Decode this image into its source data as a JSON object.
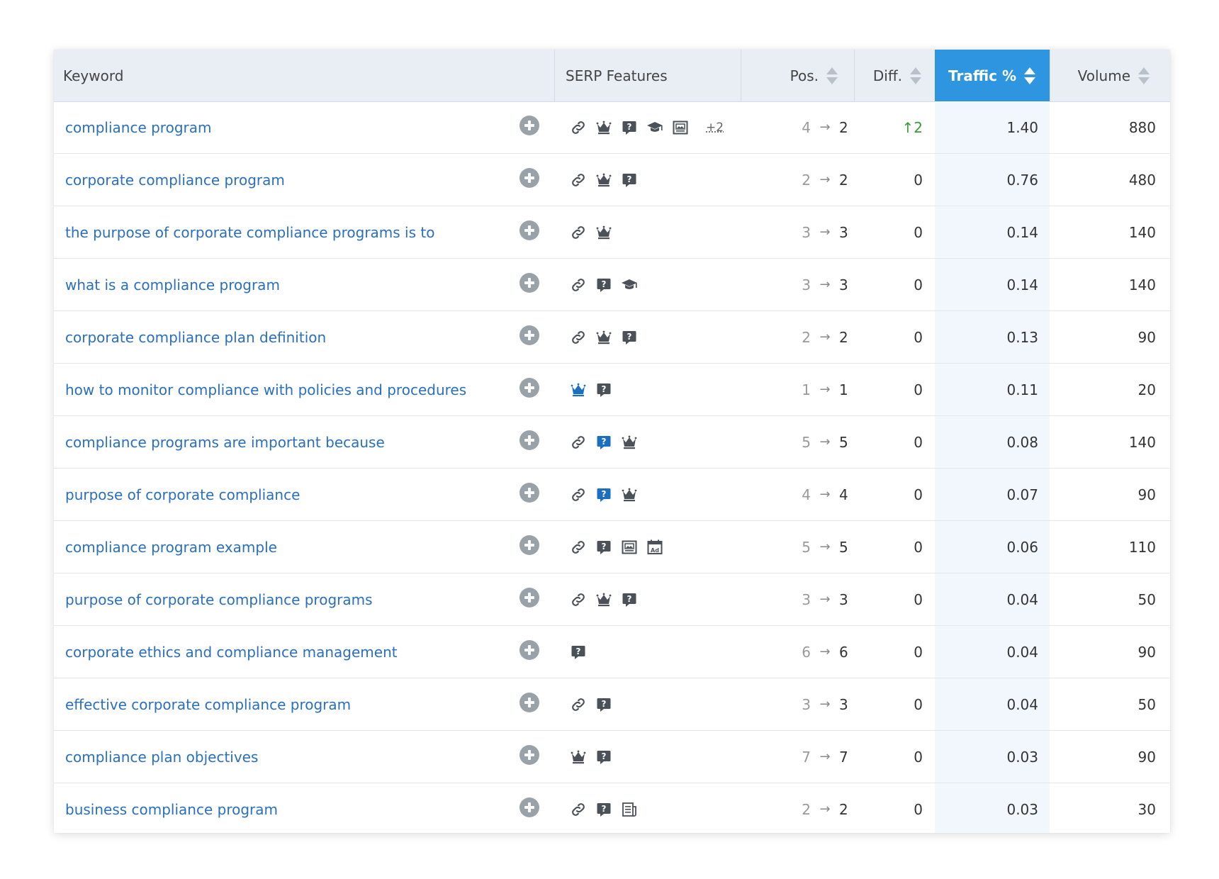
{
  "columns": {
    "keyword": "Keyword",
    "serp": "SERP Features",
    "pos": "Pos.",
    "diff": "Diff.",
    "traffic": "Traffic %",
    "volume": "Volume"
  },
  "colors": {
    "header_bg": "#e8eef4",
    "active_header_bg": "#2e96e0",
    "link": "#2a6fbd",
    "icon_dark": "#4a5158",
    "icon_blue": "#1a6fc0",
    "diff_up": "#3a9a3a"
  },
  "rows": [
    {
      "keyword": "compliance program",
      "serp": [
        {
          "type": "link-icon"
        },
        {
          "type": "crown-icon"
        },
        {
          "type": "question-icon"
        },
        {
          "type": "graduation-cap-icon"
        },
        {
          "type": "image-icon"
        }
      ],
      "more": "+2",
      "prev": "4",
      "cur": "2",
      "diff": "↑2",
      "diff_up": true,
      "traffic": "1.40",
      "volume": "880"
    },
    {
      "keyword": "corporate compliance program",
      "serp": [
        {
          "type": "link-icon"
        },
        {
          "type": "crown-icon"
        },
        {
          "type": "question-icon"
        }
      ],
      "more": "",
      "prev": "2",
      "cur": "2",
      "diff": "0",
      "diff_up": false,
      "traffic": "0.76",
      "volume": "480"
    },
    {
      "keyword": "the purpose of corporate compliance programs is to",
      "serp": [
        {
          "type": "link-icon"
        },
        {
          "type": "crown-icon"
        }
      ],
      "more": "",
      "prev": "3",
      "cur": "3",
      "diff": "0",
      "diff_up": false,
      "traffic": "0.14",
      "volume": "140"
    },
    {
      "keyword": "what is a compliance program",
      "serp": [
        {
          "type": "link-icon"
        },
        {
          "type": "question-icon"
        },
        {
          "type": "graduation-cap-icon"
        }
      ],
      "more": "",
      "prev": "3",
      "cur": "3",
      "diff": "0",
      "diff_up": false,
      "traffic": "0.14",
      "volume": "140"
    },
    {
      "keyword": "corporate compliance plan definition",
      "serp": [
        {
          "type": "link-icon"
        },
        {
          "type": "crown-icon"
        },
        {
          "type": "question-icon"
        }
      ],
      "more": "",
      "prev": "2",
      "cur": "2",
      "diff": "0",
      "diff_up": false,
      "traffic": "0.13",
      "volume": "90"
    },
    {
      "keyword": "how to monitor compliance with policies and procedures",
      "serp": [
        {
          "type": "crown-icon",
          "active": true
        },
        {
          "type": "question-icon"
        }
      ],
      "more": "",
      "prev": "1",
      "cur": "1",
      "diff": "0",
      "diff_up": false,
      "traffic": "0.11",
      "volume": "20"
    },
    {
      "keyword": "compliance programs are important because",
      "serp": [
        {
          "type": "link-icon"
        },
        {
          "type": "question-icon",
          "active": true
        },
        {
          "type": "crown-icon"
        }
      ],
      "more": "",
      "prev": "5",
      "cur": "5",
      "diff": "0",
      "diff_up": false,
      "traffic": "0.08",
      "volume": "140"
    },
    {
      "keyword": "purpose of corporate compliance",
      "serp": [
        {
          "type": "link-icon"
        },
        {
          "type": "question-icon",
          "active": true
        },
        {
          "type": "crown-icon"
        }
      ],
      "more": "",
      "prev": "4",
      "cur": "4",
      "diff": "0",
      "diff_up": false,
      "traffic": "0.07",
      "volume": "90"
    },
    {
      "keyword": "compliance program example",
      "serp": [
        {
          "type": "link-icon"
        },
        {
          "type": "question-icon"
        },
        {
          "type": "image-icon"
        },
        {
          "type": "calendar-icon"
        }
      ],
      "more": "",
      "prev": "5",
      "cur": "5",
      "diff": "0",
      "diff_up": false,
      "traffic": "0.06",
      "volume": "110"
    },
    {
      "keyword": "purpose of corporate compliance programs",
      "serp": [
        {
          "type": "link-icon"
        },
        {
          "type": "crown-icon"
        },
        {
          "type": "question-icon"
        }
      ],
      "more": "",
      "prev": "3",
      "cur": "3",
      "diff": "0",
      "diff_up": false,
      "traffic": "0.04",
      "volume": "50"
    },
    {
      "keyword": "corporate ethics and compliance management",
      "serp": [
        {
          "type": "question-icon"
        }
      ],
      "more": "",
      "prev": "6",
      "cur": "6",
      "diff": "0",
      "diff_up": false,
      "traffic": "0.04",
      "volume": "90"
    },
    {
      "keyword": "effective corporate compliance program",
      "serp": [
        {
          "type": "link-icon"
        },
        {
          "type": "question-icon"
        }
      ],
      "more": "",
      "prev": "3",
      "cur": "3",
      "diff": "0",
      "diff_up": false,
      "traffic": "0.04",
      "volume": "50"
    },
    {
      "keyword": "compliance plan objectives",
      "serp": [
        {
          "type": "crown-icon"
        },
        {
          "type": "question-icon"
        }
      ],
      "more": "",
      "prev": "7",
      "cur": "7",
      "diff": "0",
      "diff_up": false,
      "traffic": "0.03",
      "volume": "90"
    },
    {
      "keyword": "business compliance program",
      "serp": [
        {
          "type": "link-icon"
        },
        {
          "type": "question-icon"
        },
        {
          "type": "news-icon"
        }
      ],
      "more": "",
      "prev": "2",
      "cur": "2",
      "diff": "0",
      "diff_up": false,
      "traffic": "0.03",
      "volume": "30"
    }
  ]
}
